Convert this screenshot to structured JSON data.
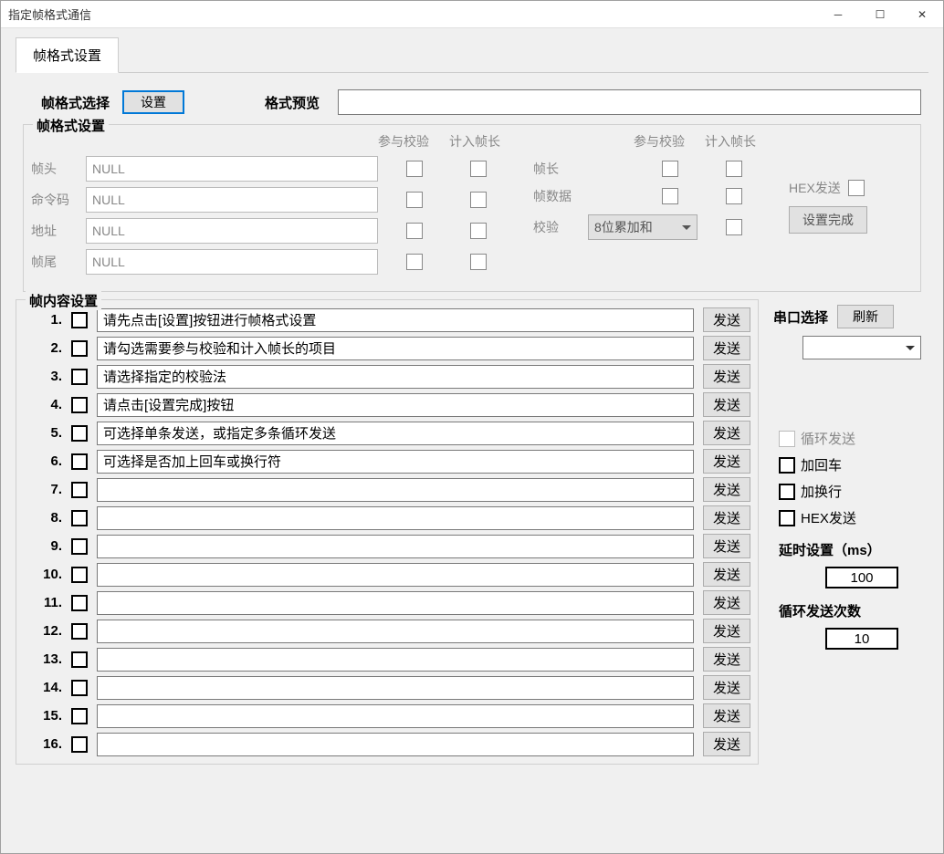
{
  "window": {
    "title": "指定帧格式通信"
  },
  "tabs": [
    {
      "label": "帧格式设置"
    }
  ],
  "toprow": {
    "select_label": "帧格式选择",
    "settings_btn": "设置",
    "preview_label": "格式预览",
    "preview_value": ""
  },
  "fmt": {
    "group_label": "帧格式设置",
    "hdr_verify": "参与校验",
    "hdr_count": "计入帧长",
    "rows_left": [
      {
        "label": "帧头",
        "value": "NULL"
      },
      {
        "label": "命令码",
        "value": "NULL"
      },
      {
        "label": "地址",
        "value": "NULL"
      },
      {
        "label": "帧尾",
        "value": "NULL"
      }
    ],
    "rows_mid": [
      {
        "label": "帧长"
      },
      {
        "label": "帧数据"
      },
      {
        "label": "校验",
        "combo": "8位累加和"
      }
    ],
    "hex_send": "HEX发送",
    "finish_btn": "设置完成"
  },
  "content": {
    "group_label": "帧内容设置",
    "send_btn": "发送",
    "rows": [
      {
        "n": "1.",
        "text": "请先点击[设置]按钮进行帧格式设置"
      },
      {
        "n": "2.",
        "text": "请勾选需要参与校验和计入帧长的项目"
      },
      {
        "n": "3.",
        "text": "请选择指定的校验法"
      },
      {
        "n": "4.",
        "text": "请点击[设置完成]按钮"
      },
      {
        "n": "5.",
        "text": "可选择单条发送，或指定多条循环发送"
      },
      {
        "n": "6.",
        "text": "可选择是否加上回车或换行符"
      },
      {
        "n": "7.",
        "text": ""
      },
      {
        "n": "8.",
        "text": ""
      },
      {
        "n": "9.",
        "text": ""
      },
      {
        "n": "10.",
        "text": ""
      },
      {
        "n": "11.",
        "text": ""
      },
      {
        "n": "12.",
        "text": ""
      },
      {
        "n": "13.",
        "text": ""
      },
      {
        "n": "14.",
        "text": ""
      },
      {
        "n": "15.",
        "text": ""
      },
      {
        "n": "16.",
        "text": ""
      }
    ]
  },
  "sidebar": {
    "port_label": "串口选择",
    "refresh_btn": "刷新",
    "port_value": "",
    "loop_send": "循环发送",
    "add_cr": "加回车",
    "add_lf": "加换行",
    "hex_send": "HEX发送",
    "delay_label": "延时设置（ms）",
    "delay_value": "100",
    "loop_count_label": "循环发送次数",
    "loop_count_value": "10"
  }
}
